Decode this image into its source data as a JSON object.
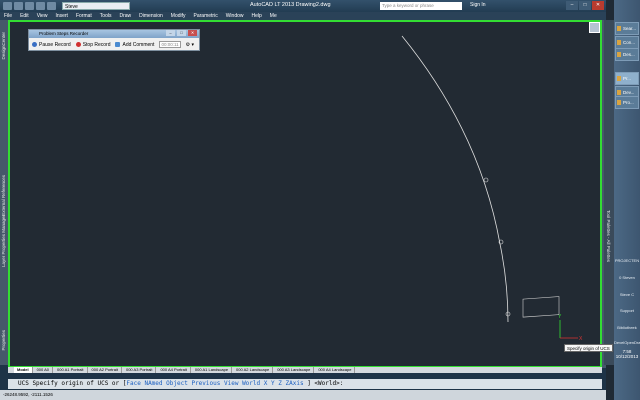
{
  "window": {
    "workspace": "Steve",
    "title": "AutoCAD LT 2013   Drawing2.dwg",
    "search_placeholder": "Type a keyword or phrase",
    "signin": "Sign In"
  },
  "menu": [
    "File",
    "Edit",
    "View",
    "Insert",
    "Format",
    "Tools",
    "Draw",
    "Dimension",
    "Modify",
    "Parametric",
    "Window",
    "Help",
    "Me"
  ],
  "left_palettes": [
    "DesignCenter",
    "External References",
    "Layer Properties Manager",
    "Properties"
  ],
  "right_palette": "Tool Palettes - All Palettes",
  "steps_recorder": {
    "title": "Problem Steps Recorder",
    "pause": "Pause Record",
    "stop": "Stop Record",
    "add_comment": "Add Comment",
    "timer": "00:00:11"
  },
  "layout_tabs": [
    "Model",
    "000 A0",
    "000 A1 Portrait",
    "000 A2 Portrait",
    "000 A3 Portrait",
    "000 A4 Portrait",
    "000 A1 Landscape",
    "000 A2 Landscape",
    "000 A3 Landscape",
    "000 A4 Landscape"
  ],
  "command_line": {
    "prefix": "UCS Specify origin of UCS or [",
    "options": [
      "Face",
      "NAmed",
      "Object",
      "Previous",
      "View",
      "World",
      "X",
      "Y",
      "Z",
      "ZAxis"
    ],
    "suffix": "] <World>:"
  },
  "tooltip": "Specify origin of UCS",
  "status_coords": "-26248.9592, -2111.1526",
  "taskbar_items": [
    "Sear...",
    "Con...",
    "Des...",
    "Pr...",
    "Dev...",
    "Pro..."
  ],
  "taskbar_labels": [
    "PROJECTEN",
    "0 Steven",
    "Steve C",
    "Support",
    "Bibliotheek",
    "DevelOpenDraw"
  ],
  "clock": {
    "time": "7:58",
    "date": "10/12/2013"
  },
  "colors": {
    "viewport_border": "#33dd33",
    "canvas": "#222a33",
    "curve": "#e0e0e0"
  }
}
